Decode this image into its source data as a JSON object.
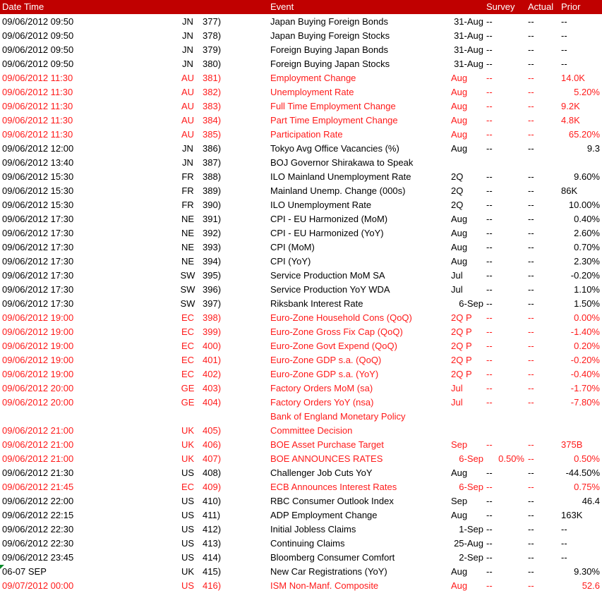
{
  "header": {
    "datetime": "Date Time",
    "event": "Event",
    "survey": "Survey",
    "actual": "Actual",
    "prior": "Prior"
  },
  "colors": {
    "header_bg": "#c00000",
    "highlight_text": "#ff1a1a"
  },
  "rows": [
    {
      "dt": "09/06/2012 09:50",
      "cty": "JN",
      "num": "377)",
      "ev": "Japan Buying Foreign Bonds",
      "per": "31-Aug",
      "sur": "--",
      "act": "--",
      "pri": "--",
      "hl": false
    },
    {
      "dt": "09/06/2012 09:50",
      "cty": "JN",
      "num": "378)",
      "ev": "Japan Buying Foreign Stocks",
      "per": "31-Aug",
      "sur": "--",
      "act": "--",
      "pri": "--",
      "hl": false
    },
    {
      "dt": "09/06/2012 09:50",
      "cty": "JN",
      "num": "379)",
      "ev": "Foreign Buying Japan Bonds",
      "per": "31-Aug",
      "sur": "--",
      "act": "--",
      "pri": "--",
      "hl": false
    },
    {
      "dt": "09/06/2012 09:50",
      "cty": "JN",
      "num": "380)",
      "ev": "Foreign Buying Japan Stocks",
      "per": "31-Aug",
      "sur": "--",
      "act": "--",
      "pri": "--",
      "hl": false
    },
    {
      "dt": "09/06/2012 11:30",
      "cty": "AU",
      "num": "381)",
      "ev": "Employment Change",
      "per": "Aug",
      "sur": "--",
      "act": "--",
      "pri": "14.0K",
      "hl": true
    },
    {
      "dt": "09/06/2012 11:30",
      "cty": "AU",
      "num": "382)",
      "ev": "Unemployment Rate",
      "per": "Aug",
      "sur": "--",
      "act": "--",
      "pri": "5.20%",
      "hl": true
    },
    {
      "dt": "09/06/2012 11:30",
      "cty": "AU",
      "num": "383)",
      "ev": "Full Time Employment Change",
      "per": "Aug",
      "sur": "--",
      "act": "--",
      "pri": "9.2K",
      "hl": true
    },
    {
      "dt": "09/06/2012 11:30",
      "cty": "AU",
      "num": "384)",
      "ev": "Part Time Employment Change",
      "per": "Aug",
      "sur": "--",
      "act": "--",
      "pri": "4.8K",
      "hl": true
    },
    {
      "dt": "09/06/2012 11:30",
      "cty": "AU",
      "num": "385)",
      "ev": "Participation Rate",
      "per": "Aug",
      "sur": "--",
      "act": "--",
      "pri": "65.20%",
      "hl": true
    },
    {
      "dt": "09/06/2012 12:00",
      "cty": "JN",
      "num": "386)",
      "ev": "Tokyo Avg Office Vacancies (%)",
      "per": "Aug",
      "sur": "--",
      "act": "--",
      "pri": "9.3",
      "hl": false
    },
    {
      "dt": "09/06/2012 13:40",
      "cty": "JN",
      "num": "387)",
      "ev": "BOJ Governor Shirakawa to Speak",
      "per": "",
      "sur": "",
      "act": "",
      "pri": "",
      "hl": false
    },
    {
      "dt": "09/06/2012 15:30",
      "cty": "FR",
      "num": "388)",
      "ev": "ILO Mainland Unemployment Rate",
      "per": "2Q",
      "sur": "--",
      "act": "--",
      "pri": "9.60%",
      "hl": false
    },
    {
      "dt": "09/06/2012 15:30",
      "cty": "FR",
      "num": "389)",
      "ev": "Mainland Unemp. Change (000s)",
      "per": "2Q",
      "sur": "--",
      "act": "--",
      "pri": "86K",
      "hl": false
    },
    {
      "dt": "09/06/2012 15:30",
      "cty": "FR",
      "num": "390)",
      "ev": "ILO Unemployment Rate",
      "per": "2Q",
      "sur": "--",
      "act": "--",
      "pri": "10.00%",
      "hl": false
    },
    {
      "dt": "09/06/2012 17:30",
      "cty": "NE",
      "num": "391)",
      "ev": "CPI - EU Harmonized (MoM)",
      "per": "Aug",
      "sur": "--",
      "act": "--",
      "pri": "0.40%",
      "hl": false
    },
    {
      "dt": "09/06/2012 17:30",
      "cty": "NE",
      "num": "392)",
      "ev": "CPI - EU Harmonized (YoY)",
      "per": "Aug",
      "sur": "--",
      "act": "--",
      "pri": "2.60%",
      "hl": false
    },
    {
      "dt": "09/06/2012 17:30",
      "cty": "NE",
      "num": "393)",
      "ev": "CPI (MoM)",
      "per": "Aug",
      "sur": "--",
      "act": "--",
      "pri": "0.70%",
      "hl": false
    },
    {
      "dt": "09/06/2012 17:30",
      "cty": "NE",
      "num": "394)",
      "ev": "CPI (YoY)",
      "per": "Aug",
      "sur": "--",
      "act": "--",
      "pri": "2.30%",
      "hl": false
    },
    {
      "dt": "09/06/2012 17:30",
      "cty": "SW",
      "num": "395)",
      "ev": "Service Production MoM SA",
      "per": "Jul",
      "sur": "--",
      "act": "--",
      "pri": "-0.20%",
      "hl": false
    },
    {
      "dt": "09/06/2012 17:30",
      "cty": "SW",
      "num": "396)",
      "ev": "Service Production YoY WDA",
      "per": "Jul",
      "sur": "--",
      "act": "--",
      "pri": "1.10%",
      "hl": false
    },
    {
      "dt": "09/06/2012 17:30",
      "cty": "SW",
      "num": "397)",
      "ev": "Riksbank Interest Rate",
      "per": "6-Sep",
      "sur": "--",
      "act": "--",
      "pri": "1.50%",
      "hl": false
    },
    {
      "dt": "09/06/2012 19:00",
      "cty": "EC",
      "num": "398)",
      "ev": "Euro-Zone Household Cons (QoQ)",
      "per": "2Q P",
      "sur": "--",
      "act": "--",
      "pri": "0.00%",
      "hl": true
    },
    {
      "dt": "09/06/2012 19:00",
      "cty": "EC",
      "num": "399)",
      "ev": "Euro-Zone Gross Fix Cap (QoQ)",
      "per": "2Q P",
      "sur": "--",
      "act": "--",
      "pri": "-1.40%",
      "hl": true
    },
    {
      "dt": "09/06/2012 19:00",
      "cty": "EC",
      "num": "400)",
      "ev": "Euro-Zone Govt Expend (QoQ)",
      "per": "2Q P",
      "sur": "--",
      "act": "--",
      "pri": "0.20%",
      "hl": true
    },
    {
      "dt": "09/06/2012 19:00",
      "cty": "EC",
      "num": "401)",
      "ev": "Euro-Zone GDP s.a. (QoQ)",
      "per": "2Q P",
      "sur": "--",
      "act": "--",
      "pri": "-0.20%",
      "hl": true
    },
    {
      "dt": "09/06/2012 19:00",
      "cty": "EC",
      "num": "402)",
      "ev": "Euro-Zone GDP s.a. (YoY)",
      "per": "2Q P",
      "sur": "--",
      "act": "--",
      "pri": "-0.40%",
      "hl": true
    },
    {
      "dt": "09/06/2012 20:00",
      "cty": "GE",
      "num": "403)",
      "ev": "Factory Orders MoM (sa)",
      "per": "Jul",
      "sur": "--",
      "act": "--",
      "pri": "-1.70%",
      "hl": true
    },
    {
      "dt": "09/06/2012 20:00",
      "cty": "GE",
      "num": "404)",
      "ev": "Factory Orders YoY (nsa)",
      "per": "Jul",
      "sur": "--",
      "act": "--",
      "pri": "-7.80%",
      "hl": true
    },
    {
      "dt": "",
      "cty": "",
      "num": "",
      "ev": "Bank of England Monetary Policy",
      "per": "",
      "sur": "",
      "act": "",
      "pri": "",
      "hl": true
    },
    {
      "dt": "09/06/2012 21:00",
      "cty": "UK",
      "num": "405)",
      "ev": "Committee Decision",
      "per": "",
      "sur": "",
      "act": "",
      "pri": "",
      "hl": true
    },
    {
      "dt": "09/06/2012 21:00",
      "cty": "UK",
      "num": "406)",
      "ev": "BOE Asset Purchase Target",
      "per": "Sep",
      "sur": "--",
      "act": "--",
      "pri": "375B",
      "hl": true
    },
    {
      "dt": "09/06/2012 21:00",
      "cty": "UK",
      "num": "407)",
      "ev": "BOE ANNOUNCES RATES",
      "per": "6-Sep",
      "sur": "0.50%",
      "act": "--",
      "pri": "0.50%",
      "hl": true
    },
    {
      "dt": "09/06/2012 21:30",
      "cty": "US",
      "num": "408)",
      "ev": "Challenger Job Cuts YoY",
      "per": "Aug",
      "sur": "--",
      "act": "--",
      "pri": "-44.50%",
      "hl": false
    },
    {
      "dt": "09/06/2012 21:45",
      "cty": "EC",
      "num": "409)",
      "ev": "ECB Announces Interest Rates",
      "per": "6-Sep",
      "sur": "--",
      "act": "--",
      "pri": "0.75%",
      "hl": true
    },
    {
      "dt": "09/06/2012 22:00",
      "cty": "US",
      "num": "410)",
      "ev": "RBC Consumer Outlook Index",
      "per": "Sep",
      "sur": "--",
      "act": "--",
      "pri": "46.4",
      "hl": false
    },
    {
      "dt": "09/06/2012 22:15",
      "cty": "US",
      "num": "411)",
      "ev": "ADP Employment Change",
      "per": "Aug",
      "sur": "--",
      "act": "--",
      "pri": "163K",
      "hl": false
    },
    {
      "dt": "09/06/2012 22:30",
      "cty": "US",
      "num": "412)",
      "ev": "Initial Jobless Claims",
      "per": "1-Sep",
      "sur": "--",
      "act": "--",
      "pri": "--",
      "hl": false
    },
    {
      "dt": "09/06/2012 22:30",
      "cty": "US",
      "num": "413)",
      "ev": "Continuing Claims",
      "per": "25-Aug",
      "sur": "--",
      "act": "--",
      "pri": "--",
      "hl": false
    },
    {
      "dt": "09/06/2012 23:45",
      "cty": "US",
      "num": "414)",
      "ev": "Bloomberg Consumer Comfort",
      "per": "2-Sep",
      "sur": "--",
      "act": "--",
      "pri": "--",
      "hl": false
    },
    {
      "dt": "06-07 SEP",
      "cty": "UK",
      "num": "415)",
      "ev": "New Car Registrations (YoY)",
      "per": "Aug",
      "sur": "--",
      "act": "--",
      "pri": "9.30%",
      "hl": false,
      "comment": true
    },
    {
      "dt": "09/07/2012 00:00",
      "cty": "US",
      "num": "416)",
      "ev": "ISM Non-Manf. Composite",
      "per": "Aug",
      "sur": "--",
      "act": "--",
      "pri": "52.6",
      "hl": true
    }
  ]
}
